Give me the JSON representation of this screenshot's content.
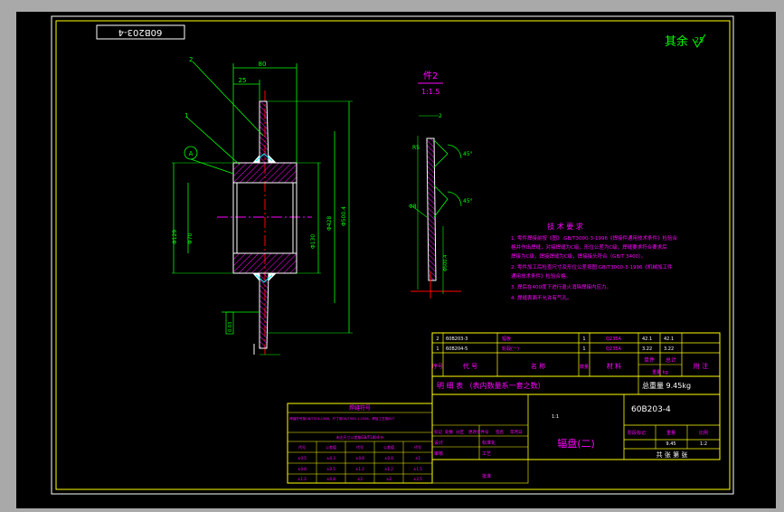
{
  "colors": {
    "canvas": "#000000",
    "border": "#ffffff",
    "frame": "#ffff00",
    "dim": "#00ff00",
    "outline": "#ffffff",
    "hatch": "#ff00ff",
    "axis": "#ff0000",
    "text_cn": "#ff00ff",
    "table_text": "#ffffff",
    "centerline": "#ff00ff"
  },
  "drawing": {
    "stamp_code": "60B203-4",
    "surface_note": "其余",
    "surface_ra": "25",
    "main_view": {
      "dim_top_total": "80",
      "dim_top_hub": "25",
      "label_part1": "1",
      "label_part2": "2",
      "datum": "A",
      "dims_left": [
        "Φ129",
        "Φ70"
      ],
      "dims_right": [
        "Φ130",
        "Φ428",
        "Φ500.4"
      ],
      "tol_bottom": "0.03"
    },
    "detail_view": {
      "title": "件2",
      "scale": "1:1.5",
      "dims": [
        "2",
        "R5",
        "45°",
        "45°",
        "Φ8",
        "Φ500.4"
      ]
    },
    "tech_req": {
      "title": "技 术 要 求",
      "lines": [
        "1. 零件焊接前按《图》.GB/T3000-3-1996《焊接件通用技术条件》检验合",
        "   格并作出焊缝，对接焊缝为C级，形位公差为C级，焊缝要求符合要求后",
        "   焊接为C级，焊接焊缝为C级，焊接接头符合（GB/T 3400）。",
        "2. 零件加工后检查尺寸及形位公差按图.GB/T3000-3-1996《机械加工件",
        "   通用技术条件》检验合格。",
        "3. 焊后在400度下进行退火消除焊接内应力。",
        "4. 焊缝表面不允许有气孔。"
      ]
    },
    "bom": {
      "rows": [
        [
          "2",
          "60B203-3",
          "辐板",
          "1",
          "Q235A",
          "42.1",
          "42.1",
          ""
        ],
        [
          "1",
          "60B204-5",
          "轮毂(一)",
          "1",
          "Q235A",
          "3.22",
          "3.22",
          ""
        ]
      ],
      "header": [
        "序号",
        "代 号",
        "名 称",
        "数量",
        "材 料",
        "单件",
        "总计",
        "附 注"
      ],
      "header_sub": "重量 kg",
      "ledger_label": "明 细 表 （表内数量系一套之数）",
      "total_weight": "总重量 9.45kg"
    },
    "title_block": {
      "drawing_no": "60B203-4",
      "part_name": "辐盘(二)",
      "scale_text": "1:1",
      "material_area": "",
      "stage_label": "阶段标记",
      "weight_label": "重量",
      "scale_label": "比例",
      "weight_value": "9.45",
      "scale_value": "1:2",
      "sheet_label": "共 张 第 张",
      "row_labels": [
        "标记",
        "处数",
        "分区",
        "更改文件号",
        "签名",
        "年月日"
      ],
      "roles": [
        "设计",
        "标准化",
        "审核",
        "工艺",
        "批准"
      ]
    },
    "weld_table": {
      "title": "焊缝符号",
      "note": "焊缝符号按GB/T324-1988，尺寸按GB/T985.1-2008，焊接工艺按JB/T",
      "sub": "未注尺寸公差按GB/T1804-m",
      "header": [
        "代号",
        "公差值",
        "代号",
        "公差值",
        "代号"
      ],
      "rows": [
        [
          "±0.5",
          "±0.3",
          "±0.8",
          "±0.8",
          "±1"
        ],
        [
          "±0.8",
          "±0.5",
          "±1.2",
          "±1.2",
          "±1.5"
        ],
        [
          "±1.2",
          "±0.8",
          "±2",
          "±2",
          "±2.5"
        ]
      ]
    }
  }
}
